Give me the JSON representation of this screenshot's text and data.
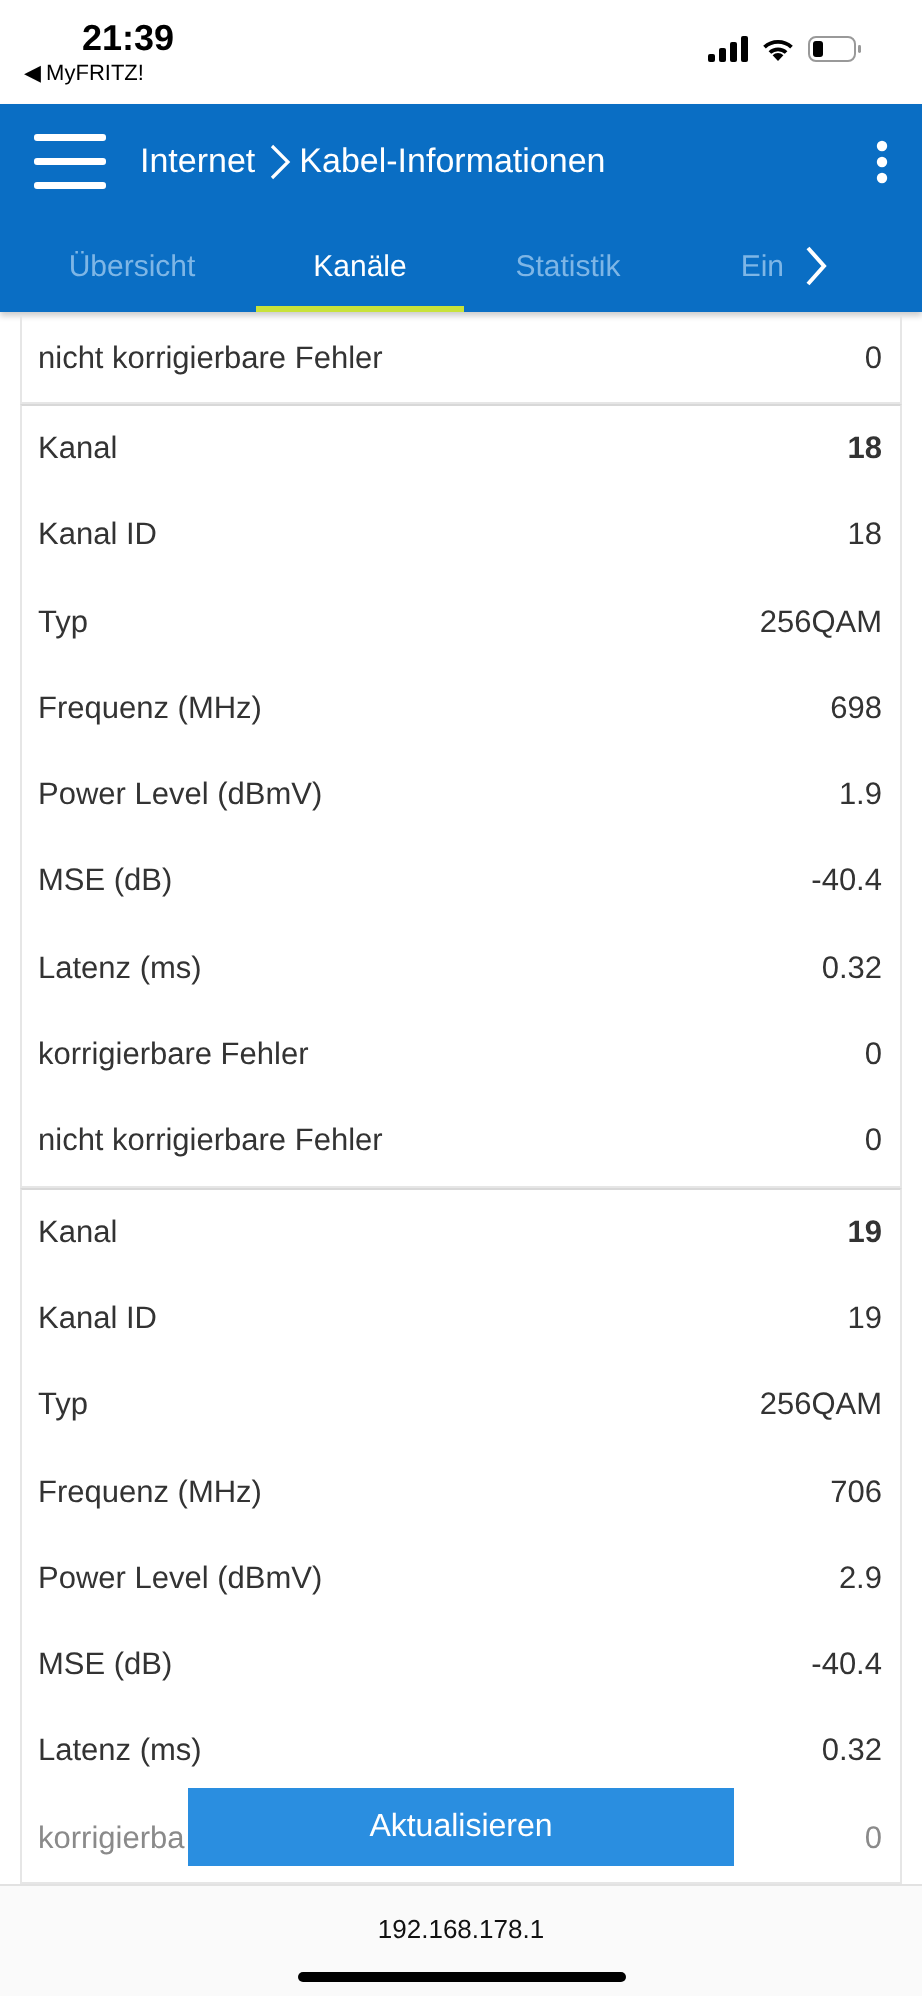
{
  "status_bar": {
    "time": "21:39",
    "back_link": "◀ MyFRITZ!"
  },
  "header": {
    "breadcrumb": "Internet",
    "title": "Kabel-Informationen"
  },
  "tabs": [
    {
      "label": "Übersicht",
      "selected": false
    },
    {
      "label": "Kanäle",
      "selected": true
    },
    {
      "label": "Statistik",
      "selected": false
    },
    {
      "label": "Ein",
      "selected": false
    }
  ],
  "top_row": {
    "label": "nicht korrigierbare Fehler",
    "value": "0"
  },
  "channels": [
    {
      "rows": [
        {
          "label": "Kanal",
          "value": "18"
        },
        {
          "label": "Kanal ID",
          "value": "18"
        },
        {
          "label": "Typ",
          "value": "256QAM"
        },
        {
          "label": "Frequenz (MHz)",
          "value": "698"
        },
        {
          "label": "Power Level (dBmV)",
          "value": "1.9"
        },
        {
          "label": "MSE (dB)",
          "value": "-40.4"
        },
        {
          "label": "Latenz (ms)",
          "value": "0.32"
        },
        {
          "label": "korrigierbare Fehler",
          "value": "0"
        },
        {
          "label": "nicht korrigierbare Fehler",
          "value": "0"
        }
      ]
    },
    {
      "rows": [
        {
          "label": "Kanal",
          "value": "19"
        },
        {
          "label": "Kanal ID",
          "value": "19"
        },
        {
          "label": "Typ",
          "value": "256QAM"
        },
        {
          "label": "Frequenz (MHz)",
          "value": "706"
        },
        {
          "label": "Power Level (dBmV)",
          "value": "2.9"
        },
        {
          "label": "MSE (dB)",
          "value": "-40.4"
        },
        {
          "label": "Latenz (ms)",
          "value": "0.32"
        }
      ]
    }
  ],
  "partial_row": {
    "label": "korrigierba",
    "value": "0"
  },
  "refresh_button": "Aktualisieren",
  "address_bar": "192.168.178.1"
}
